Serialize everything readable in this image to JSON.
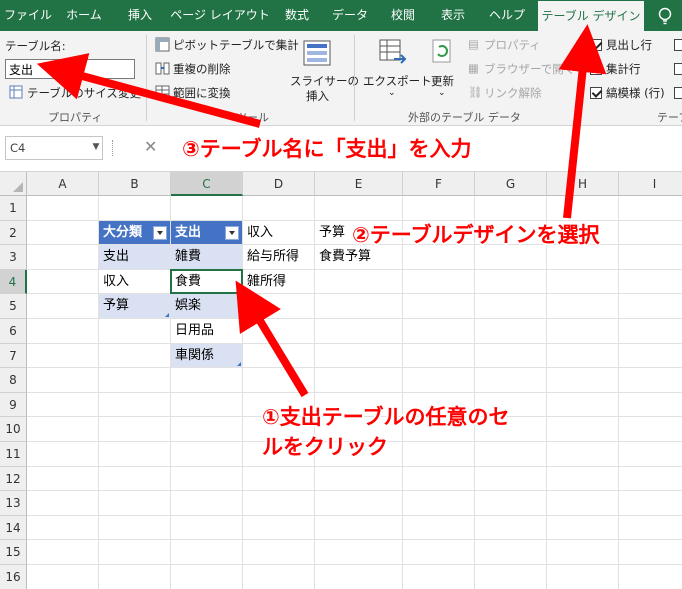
{
  "tabs": [
    {
      "label": "ファイル",
      "active": false
    },
    {
      "label": "ホーム",
      "active": false
    },
    {
      "label": "挿入",
      "active": false
    },
    {
      "label": "ページ レイアウト",
      "active": false
    },
    {
      "label": "数式",
      "active": false
    },
    {
      "label": "データ",
      "active": false
    },
    {
      "label": "校閲",
      "active": false
    },
    {
      "label": "表示",
      "active": false
    },
    {
      "label": "ヘルプ",
      "active": false
    },
    {
      "label": "テーブル デザイン",
      "active": true
    }
  ],
  "ribbon": {
    "properties": {
      "table_name_label": "テーブル名:",
      "table_name_value": "支出",
      "resize_label": "テーブルのサイズ変更",
      "group_label": "プロパティ"
    },
    "tools": {
      "pivot_label": "ピボットテーブルで集計",
      "remove_duplicates_label": "重複の削除",
      "convert_range_label": "範囲に変換",
      "slicer_label_1": "スライサーの",
      "slicer_label_2": "挿入",
      "group_label": "ツール"
    },
    "external": {
      "export_label": "エクスポート",
      "refresh_label": "更新",
      "properties_label": "プロパティ",
      "browser_label": "ブラウザーで開く",
      "unlink_label": "リンク解除",
      "group_label": "外部のテーブル データ"
    },
    "style_options": {
      "header_row_label": "見出し行",
      "total_row_label": "集計行",
      "banded_rows_label": "縞模様 (行)",
      "group_label": "テーブ"
    }
  },
  "formula_bar": {
    "name_box": "C4",
    "cancel_symbol": "✕"
  },
  "columns": [
    "A",
    "B",
    "C",
    "D",
    "E",
    "F",
    "G",
    "H",
    "I"
  ],
  "selected_column": "C",
  "rows": [
    "1",
    "2",
    "3",
    "4",
    "5",
    "6",
    "7",
    "8",
    "9",
    "10",
    "11",
    "12",
    "13",
    "14",
    "15",
    "16"
  ],
  "selected_row": "4",
  "cells": {
    "B2": "大分類",
    "C2": "支出",
    "D2": "収入",
    "E2": "予算",
    "B3": "支出",
    "C3": "雑費",
    "D3": "給与所得",
    "E3": "食費予算",
    "B4": "収入",
    "C4": "食費",
    "D4": "雑所得",
    "B5": "予算",
    "C5": "娯楽",
    "C6": "日用品",
    "C7": "車関係"
  },
  "annotations": {
    "step1_line1": "①支出テーブルの任意のセ",
    "step1_line2": "ルをクリック",
    "step2": "②テーブルデザインを選択",
    "step3": "③テーブル名に「支出」を入力"
  },
  "colors": {
    "excel_green": "#217346",
    "table_header": "#4472c4",
    "table_band": "#d9e1f2",
    "annotation_red": "#ff0000"
  }
}
